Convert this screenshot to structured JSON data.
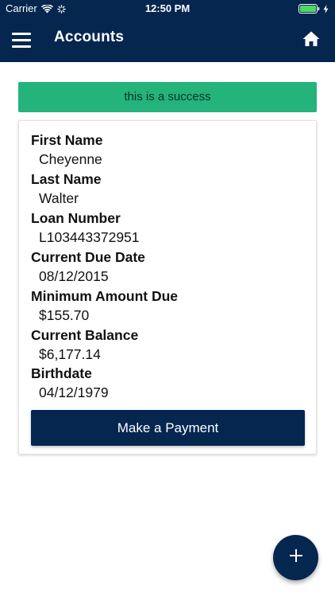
{
  "status_bar": {
    "carrier": "Carrier",
    "time": "12:50 PM",
    "icons": [
      "wifi-icon",
      "activity-icon",
      "battery-icon",
      "charging-bolt-icon"
    ]
  },
  "header": {
    "title": "Accounts",
    "menu_icon": "hamburger-menu-icon",
    "home_icon": "home-icon"
  },
  "banner": {
    "message": "this is a success",
    "color": "#24b37a"
  },
  "account": {
    "fields": [
      {
        "label": "First Name",
        "value": "Cheyenne"
      },
      {
        "label": "Last Name",
        "value": "Walter"
      },
      {
        "label": "Loan Number",
        "value": "L103443372951"
      },
      {
        "label": "Current Due Date",
        "value": "08/12/2015"
      },
      {
        "label": "Minimum Amount Due",
        "value": "$155.70"
      },
      {
        "label": "Current Balance",
        "value": "$6,177.14"
      },
      {
        "label": "Birthdate",
        "value": "04/12/1979"
      }
    ],
    "pay_button_label": "Make a Payment"
  },
  "fab": {
    "icon": "plus-icon"
  },
  "colors": {
    "primary": "#05264f",
    "success": "#24b37a",
    "battery": "#4cd964"
  }
}
